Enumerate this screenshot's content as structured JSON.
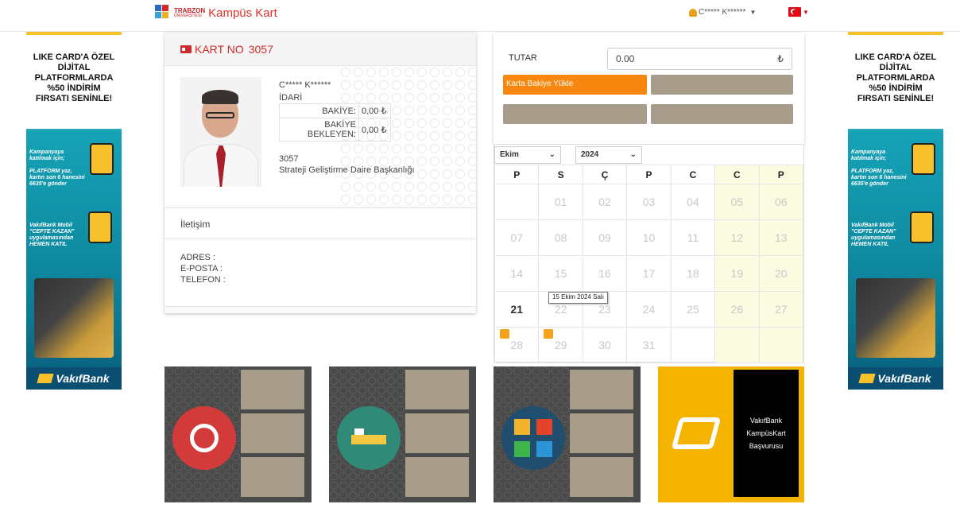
{
  "header": {
    "brand_university": "TRABZON",
    "brand_university_sub": "ÜNİVERSİTESİ",
    "app_title": "Kampüs Kart",
    "user_name": "C***** K******",
    "language": "TR"
  },
  "banner": {
    "headline": "LIKE CARD'A ÖZEL DİJİTAL PLATFORMLARDA %50 İNDİRİM FIRSATI SENİNLE!",
    "promo1_small": "Kampanyaya katılmak için;",
    "promo1_text": "PLATFORM yaz, kartın son 6 hanesini 6635'e gönder",
    "promo1_badge": "SMS",
    "promo2_text": "VakıfBank Mobil \"CEPTE KAZAN\" uygulamasından HEMEN KATIL",
    "brand": "VakıfBank"
  },
  "card": {
    "title_label": "KART NO",
    "card_no": "3057",
    "holder_name": "C***** K******",
    "role": "İDARİ",
    "balance_label": "BAKİYE:",
    "balance_value": "0,00 ₺",
    "pending_label": "BAKİYE BEKLEYEN:",
    "pending_value": "0,00 ₺",
    "id_number": "3057",
    "department": "Strateji Geliştirme Daire Başkanlığı"
  },
  "contact": {
    "title": "İletişim",
    "address_label": "ADRES :",
    "email_label": "E-POSTA :",
    "phone_label": "TELEFON :"
  },
  "topup": {
    "amount_label": "TUTAR",
    "amount_value": "0.00",
    "currency_symbol": "₺",
    "load_button": "Karta Bakiye Yükle"
  },
  "calendar": {
    "month": "Ekim",
    "year": "2024",
    "weekdays": [
      "P",
      "S",
      "Ç",
      "P",
      "C",
      "C",
      "P"
    ],
    "weeks": [
      [
        "",
        "01",
        "02",
        "03",
        "04",
        "05",
        "06"
      ],
      [
        "07",
        "08",
        "09",
        "10",
        "11",
        "12",
        "13"
      ],
      [
        "14",
        "15",
        "16",
        "17",
        "18",
        "19",
        "20"
      ],
      [
        "21",
        "22",
        "23",
        "24",
        "25",
        "26",
        "27"
      ],
      [
        "28",
        "29",
        "30",
        "31",
        "",
        "",
        ""
      ]
    ],
    "today": "21",
    "tooltip": "15 Ekim 2024 Salı"
  },
  "tiles": {
    "vakifbank_text_1": "VakıfBank",
    "vakifbank_text_2": "KampüsKart",
    "vakifbank_text_3": "Başvurusu"
  },
  "colors": {
    "brand_red": "#d12a2a",
    "load_orange": "#f7870e",
    "slot_grey": "#a89c8a",
    "weekend_yellow": "#fbfbe1",
    "vakifbank_yellow": "#f5b400"
  }
}
